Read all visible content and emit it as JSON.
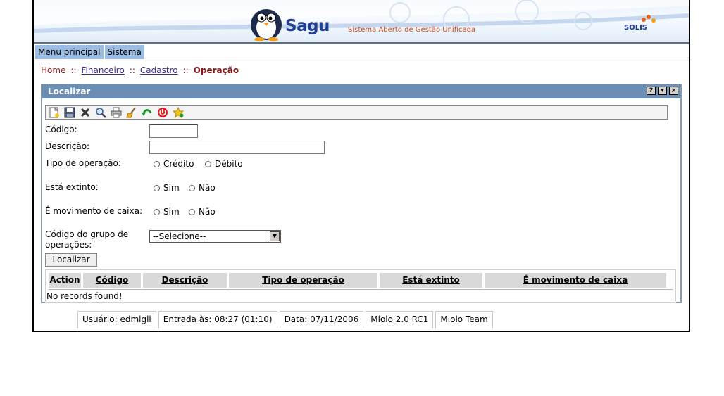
{
  "banner": {
    "logo_text": "Sagu",
    "tagline": "Sistema Aberto de Gestão Unificada",
    "partner_logo": "SOLIS"
  },
  "menu": {
    "items": [
      {
        "label": "Menu principal"
      },
      {
        "label": "Sistema"
      }
    ]
  },
  "breadcrumb": {
    "home": "Home",
    "separator": "::",
    "items": [
      "Financeiro",
      "Cadastro"
    ],
    "current": "Operação"
  },
  "panel": {
    "title": "Localizar",
    "window_buttons": {
      "help": "?",
      "minimize": "▾",
      "close": "×"
    },
    "toolbar_icons": [
      "new-icon",
      "save-icon",
      "delete-icon",
      "search-icon",
      "print-icon",
      "clear-icon",
      "back-icon",
      "exit-icon",
      "favorite-icon"
    ]
  },
  "form": {
    "codigo_label": "Código:",
    "codigo_value": "",
    "descricao_label": "Descrição:",
    "descricao_value": "",
    "tipo_label": "Tipo de operação:",
    "tipo_options": [
      "Crédito",
      "Débito"
    ],
    "extinto_label": "Está extinto:",
    "extinto_options": [
      "Sim",
      "Não"
    ],
    "caixa_label": "É movimento de caixa:",
    "caixa_options": [
      "Sim",
      "Não"
    ],
    "grupo_label_line1": "Código do grupo de",
    "grupo_label_line2": "operações:",
    "grupo_selected": "--Selecione--",
    "submit_label": "Localizar"
  },
  "grid": {
    "columns": [
      "Action",
      "Código",
      "Descrição",
      "Tipo de operação",
      "Está extinto",
      "É movimento de caixa"
    ],
    "empty_message": "No records found!"
  },
  "status": {
    "usuario": "Usuário: edmigli",
    "entrada": "Entrada às: 08:27 (01:10)",
    "data": "Data: 07/11/2006",
    "versao": "Miolo 2.0 RC1",
    "team": "Miolo Team"
  },
  "colors": {
    "menu_bg": "#9bbde3",
    "panel_title_bg": "#6a8eb4",
    "crumb_red": "#8a1616",
    "logo_blue": "#1f3f95"
  }
}
